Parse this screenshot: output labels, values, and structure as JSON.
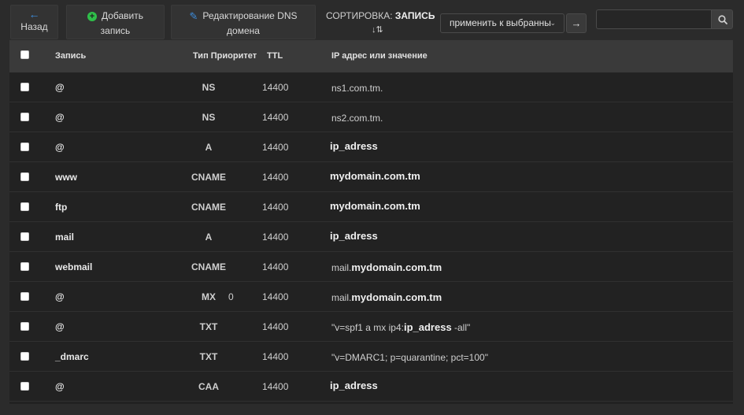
{
  "toolbar": {
    "back_label": "Назад",
    "add_label_1": "Добавить",
    "add_label_2": "запись",
    "dns_label_1": "Редактирование DNS",
    "dns_label_2": "домена",
    "sort_prefix": "СОРТИРОВКА:",
    "sort_value": "ЗАПИСЬ",
    "bulk_action_selected": "применить к выбранны",
    "search_placeholder": ""
  },
  "table": {
    "headers": {
      "record": "Запись",
      "type_priority": "Тип Приоритет",
      "ttl": "TTL",
      "value": "IP адрес или значение"
    },
    "rows": [
      {
        "name": "@",
        "type": "NS",
        "priority": "",
        "ttl": "14400",
        "prefix": "ns1.com.tm.",
        "strong": "",
        "suffix": ""
      },
      {
        "name": "@",
        "type": "NS",
        "priority": "",
        "ttl": "14400",
        "prefix": "ns2.com.tm.",
        "strong": "",
        "suffix": ""
      },
      {
        "name": "@",
        "type": "A",
        "priority": "",
        "ttl": "14400",
        "prefix": "",
        "strong": "ip_adress",
        "suffix": ""
      },
      {
        "name": "www",
        "type": "CNAME",
        "priority": "",
        "ttl": "14400",
        "prefix": "",
        "strong": "mydomain.com.tm",
        "suffix": ""
      },
      {
        "name": "ftp",
        "type": "CNAME",
        "priority": "",
        "ttl": "14400",
        "prefix": "",
        "strong": "mydomain.com.tm",
        "suffix": ""
      },
      {
        "name": "mail",
        "type": "A",
        "priority": "",
        "ttl": "14400",
        "prefix": "",
        "strong": "ip_adress",
        "suffix": ""
      },
      {
        "name": "webmail",
        "type": "CNAME",
        "priority": "",
        "ttl": "14400",
        "prefix": "mail.",
        "strong": "mydomain.com.tm",
        "suffix": ""
      },
      {
        "name": "@",
        "type": "MX",
        "priority": "0",
        "ttl": "14400",
        "prefix": "mail.",
        "strong": "mydomain.com.tm",
        "suffix": ""
      },
      {
        "name": "@",
        "type": "TXT",
        "priority": "",
        "ttl": "14400",
        "prefix": "\"v=spf1 a mx ip4:",
        "strong": "ip_adress",
        "suffix": " -all\""
      },
      {
        "name": "_dmarc",
        "type": "TXT",
        "priority": "",
        "ttl": "14400",
        "prefix": "\"v=DMARC1; p=quarantine; pct=100\"",
        "strong": "",
        "suffix": ""
      },
      {
        "name": "@",
        "type": "CAA",
        "priority": "",
        "ttl": "14400",
        "prefix": "",
        "strong": "ip_adress",
        "suffix": ""
      }
    ]
  },
  "colors": {
    "background": "#2b2b2b",
    "table_bg": "#222222",
    "header_bg": "#3a3a3a",
    "accent_blue": "#3d8fe0",
    "accent_green": "#2fbf4a"
  },
  "icons": {
    "back": "arrow-left-icon",
    "add": "plus-circle-icon",
    "edit": "pencil-icon",
    "sort": "sort-alpha-icon",
    "apply": "arrow-right-icon",
    "search": "search-icon"
  }
}
